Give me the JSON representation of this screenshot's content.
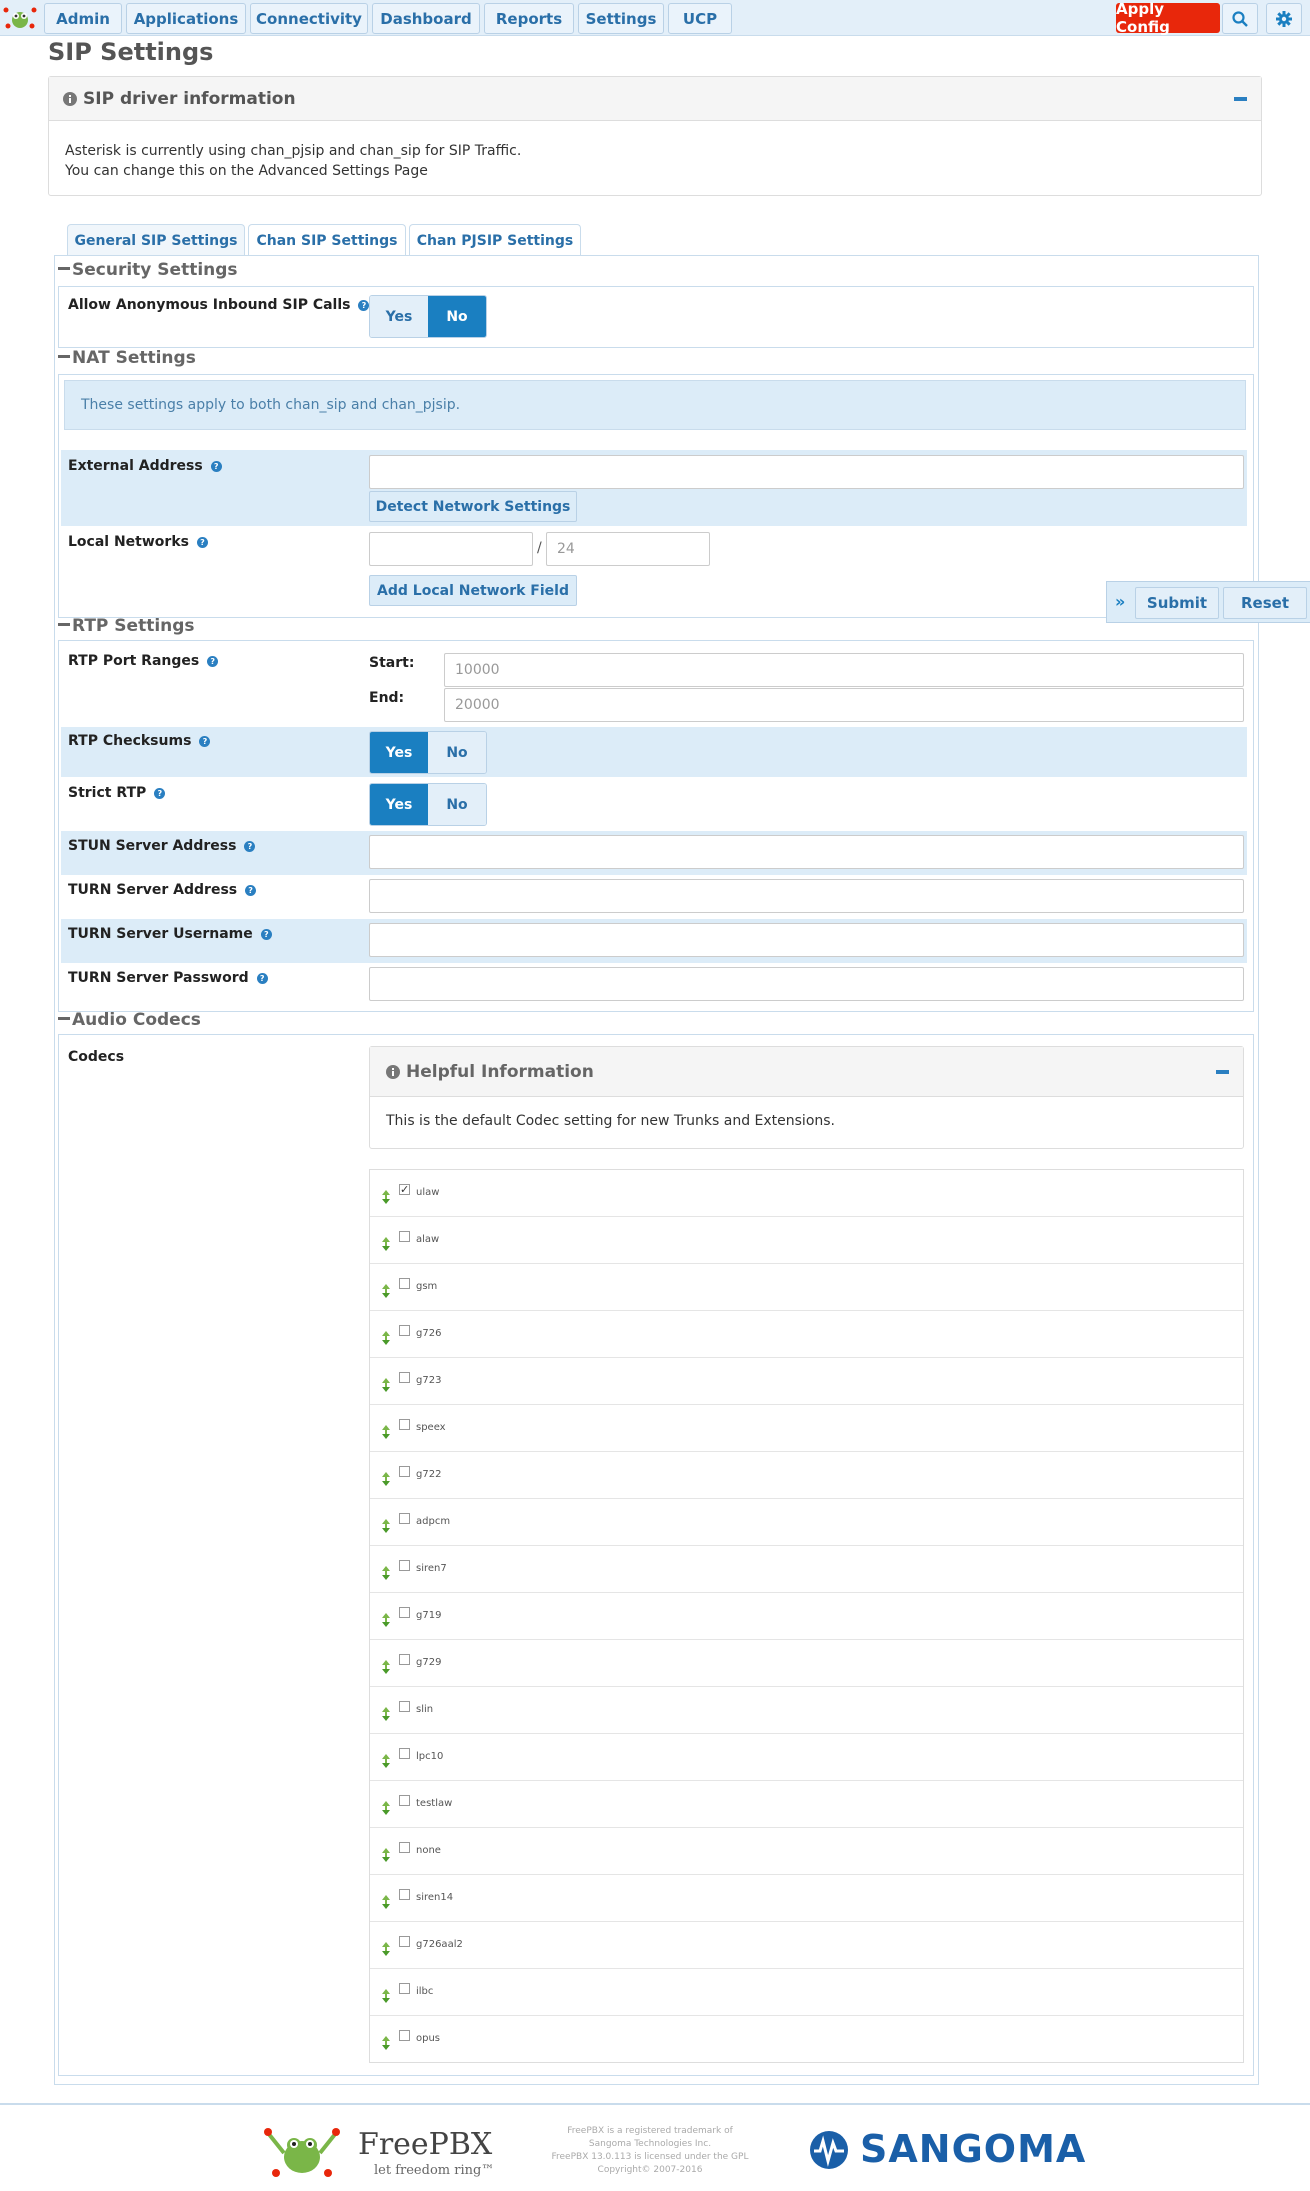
{
  "nav": {
    "items": [
      "Admin",
      "Applications",
      "Connectivity",
      "Dashboard",
      "Reports",
      "Settings",
      "UCP"
    ],
    "apply_label": "Apply Config",
    "search_icon": "search-icon",
    "settings_icon": "gear-icon"
  },
  "page": {
    "title": "SIP Settings"
  },
  "driver_info": {
    "title": "SIP driver information",
    "line1": "Asterisk is currently using chan_pjsip and chan_sip for SIP Traffic.",
    "line2": "You can change this on the Advanced Settings Page"
  },
  "tabs": [
    "General SIP Settings",
    "Chan SIP Settings",
    "Chan PJSIP Settings"
  ],
  "security": {
    "title": "Security Settings",
    "anon_label": "Allow Anonymous Inbound SIP Calls",
    "anon_value": "No",
    "yes": "Yes",
    "no": "No"
  },
  "nat": {
    "title": "NAT Settings",
    "info": "These settings apply to both chan_sip and chan_pjsip.",
    "external_label": "External Address",
    "external_value": "",
    "detect_btn": "Detect Network Settings",
    "local_label": "Local Networks",
    "local_ip": "",
    "slash": "/",
    "local_mask": "24",
    "add_btn": "Add Local Network Field"
  },
  "actions": {
    "submit": "Submit",
    "reset": "Reset",
    "expand": "»"
  },
  "rtp": {
    "title": "RTP Settings",
    "ports_label": "RTP Port Ranges",
    "start_label": "Start:",
    "start_value": "10000",
    "end_label": "End:",
    "end_value": "20000",
    "checksums_label": "RTP Checksums",
    "checksums_value": "Yes",
    "strict_label": "Strict RTP",
    "strict_value": "Yes",
    "stun_label": "STUN Server Address",
    "turn_label": "TURN Server Address",
    "turn_user_label": "TURN Server Username",
    "turn_pass_label": "TURN Server Password"
  },
  "codecs": {
    "title": "Audio Codecs",
    "label": "Codecs",
    "help_title": "Helpful Information",
    "help_text": "This is the default Codec setting for new Trunks and Extensions.",
    "items": [
      {
        "name": "ulaw",
        "checked": true
      },
      {
        "name": "alaw",
        "checked": false
      },
      {
        "name": "gsm",
        "checked": false
      },
      {
        "name": "g726",
        "checked": false
      },
      {
        "name": "g723",
        "checked": false
      },
      {
        "name": "speex",
        "checked": false
      },
      {
        "name": "g722",
        "checked": false
      },
      {
        "name": "adpcm",
        "checked": false
      },
      {
        "name": "siren7",
        "checked": false
      },
      {
        "name": "g719",
        "checked": false
      },
      {
        "name": "g729",
        "checked": false
      },
      {
        "name": "slin",
        "checked": false
      },
      {
        "name": "lpc10",
        "checked": false
      },
      {
        "name": "testlaw",
        "checked": false
      },
      {
        "name": "none",
        "checked": false
      },
      {
        "name": "siren14",
        "checked": false
      },
      {
        "name": "g726aal2",
        "checked": false
      },
      {
        "name": "ilbc",
        "checked": false
      },
      {
        "name": "opus",
        "checked": false
      }
    ]
  },
  "footer": {
    "freepbx": "FreePBX",
    "tagline": "let freedom ring™",
    "legal": [
      "FreePBX is a registered trademark of",
      "Sangoma Technologies Inc.",
      "FreePBX 13.0.113 is licensed under the GPL",
      "Copyright© 2007-2016"
    ],
    "sangoma": "SANGOMA"
  },
  "colors": {
    "accent": "#1a7fc1",
    "apply": "#e8270b",
    "nav_bg": "#e3eff9",
    "highlight": "#dcecf8"
  }
}
